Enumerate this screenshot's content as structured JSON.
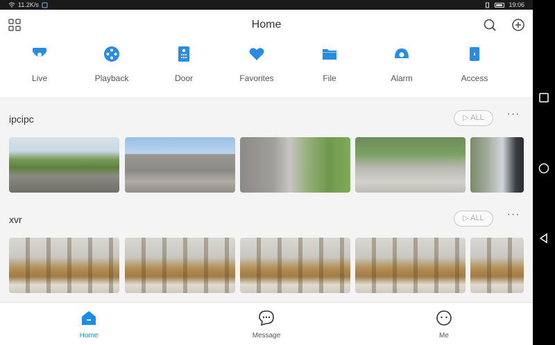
{
  "status": {
    "network": "11.2K/s",
    "time": "19:06"
  },
  "header": {
    "title": "Home"
  },
  "quick_actions": [
    {
      "label": "Live",
      "icon": "camera-icon"
    },
    {
      "label": "Playback",
      "icon": "playback-icon"
    },
    {
      "label": "Door",
      "icon": "door-icon"
    },
    {
      "label": "Favorites",
      "icon": "heart-icon"
    },
    {
      "label": "File",
      "icon": "folder-icon"
    },
    {
      "label": "Alarm",
      "icon": "alarm-icon"
    },
    {
      "label": "Access",
      "icon": "access-icon"
    }
  ],
  "sections": [
    {
      "title": "ipcipc",
      "all_label": "ALL"
    },
    {
      "title": "xvr",
      "all_label": "ALL"
    }
  ],
  "bottom_nav": [
    {
      "label": "Home",
      "icon": "home-icon",
      "active": true
    },
    {
      "label": "Message",
      "icon": "message-icon",
      "active": false
    },
    {
      "label": "Me",
      "icon": "me-icon",
      "active": false
    }
  ],
  "colors": {
    "accent": "#1e8be6",
    "background": "#f4f4f4"
  }
}
